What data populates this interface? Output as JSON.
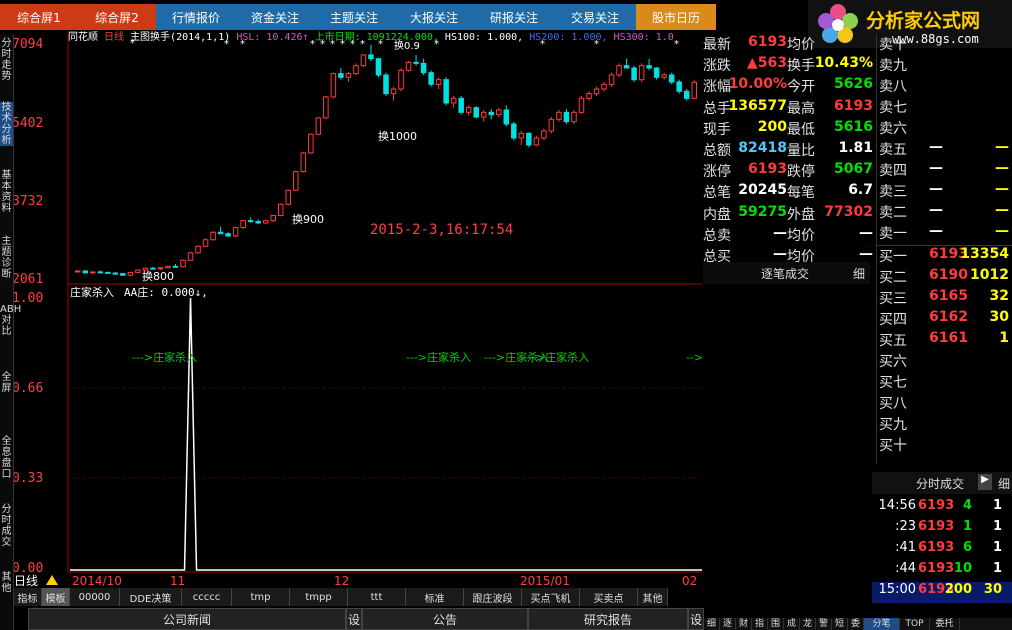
{
  "tabs": [
    "综合屏1",
    "综合屏2",
    "行情报价",
    "资金关注",
    "主题关注",
    "大报关注",
    "研报关注",
    "交易关注",
    "股市日历"
  ],
  "logo": {
    "title": "分析家公式网",
    "url": "www.88gs.com"
  },
  "left_nav": [
    "分时走势",
    "技术分析",
    "基本资料",
    "主题诊断",
    "ABH对比",
    "全屏",
    "全息盘口",
    "分时成交",
    "其他"
  ],
  "chart": {
    "header": {
      "name": "同花顺",
      "period": "日线",
      "indicator": "主图换手(2014,1,1)",
      "hsl": "HSL: 10.426↑",
      "listing": "上市日期: 1091224.000,",
      "hs100": "HS100: 1.000,",
      "hs200": "HS200: 1.000,",
      "hs300": "HS300: 1.0"
    },
    "y_labels": [
      "7094",
      "5402",
      "3732",
      "2061"
    ],
    "annotations": [
      "换1000",
      "换900",
      "换800",
      "换0.9"
    ],
    "timestamp": "2015-2-3,16:17:54",
    "sub_title": "庄家杀入",
    "sub_value": "AA庄: 0.000↓,",
    "sub_y_labels": [
      "1.00",
      "0.66",
      "0.33",
      "0.00"
    ],
    "sub_arrow_labels": [
      "--->庄家杀入",
      "--->庄家杀入",
      "--->庄家杀入",
      "--->庄家杀入",
      "-->"
    ],
    "x_labels": [
      "日线",
      "2014/10",
      "11",
      "12",
      "2015/01",
      "02"
    ]
  },
  "candles": [
    [
      2140,
      2165,
      2120,
      2150
    ],
    [
      2150,
      2170,
      2100,
      2110
    ],
    [
      2110,
      2140,
      2090,
      2130
    ],
    [
      2130,
      2160,
      2110,
      2120
    ],
    [
      2120,
      2135,
      2095,
      2105
    ],
    [
      2105,
      2130,
      2080,
      2095
    ],
    [
      2095,
      2110,
      2050,
      2060
    ],
    [
      2060,
      2130,
      2040,
      2120
    ],
    [
      2120,
      2180,
      2100,
      2170
    ],
    [
      2170,
      2220,
      2150,
      2210
    ],
    [
      2210,
      2240,
      2180,
      2195
    ],
    [
      2195,
      2230,
      2170,
      2220
    ],
    [
      2220,
      2260,
      2200,
      2250
    ],
    [
      2250,
      2300,
      2230,
      2240
    ],
    [
      2240,
      2400,
      2230,
      2380
    ],
    [
      2380,
      2560,
      2360,
      2540
    ],
    [
      2540,
      2700,
      2520,
      2680
    ],
    [
      2680,
      2850,
      2660,
      2820
    ],
    [
      2820,
      3000,
      2800,
      2980
    ],
    [
      2980,
      3100,
      2940,
      2950
    ],
    [
      2950,
      2980,
      2880,
      2900
    ],
    [
      2900,
      3100,
      2880,
      3080
    ],
    [
      3080,
      3250,
      3050,
      3230
    ],
    [
      3230,
      3300,
      3190,
      3210
    ],
    [
      3210,
      3260,
      3150,
      3180
    ],
    [
      3180,
      3250,
      3160,
      3230
    ],
    [
      3230,
      3350,
      3200,
      3340
    ],
    [
      3340,
      3600,
      3320,
      3580
    ],
    [
      3580,
      3900,
      3560,
      3880
    ],
    [
      3880,
      4300,
      3860,
      4280
    ],
    [
      4280,
      4700,
      4260,
      4680
    ],
    [
      4680,
      5100,
      4660,
      5080
    ],
    [
      5080,
      5450,
      5060,
      5430
    ],
    [
      5430,
      5900,
      5400,
      5880
    ],
    [
      5880,
      6400,
      5850,
      6380
    ],
    [
      6380,
      6500,
      6250,
      6300
    ],
    [
      6300,
      6420,
      6200,
      6380
    ],
    [
      6380,
      6600,
      6350,
      6550
    ],
    [
      6550,
      6800,
      6520,
      6780
    ],
    [
      6780,
      7000,
      6650,
      6700
    ],
    [
      6700,
      6720,
      6300,
      6350
    ],
    [
      6350,
      6400,
      5900,
      5950
    ],
    [
      5950,
      6100,
      5800,
      6050
    ],
    [
      6050,
      6500,
      6000,
      6450
    ],
    [
      6450,
      6650,
      6420,
      6620
    ],
    [
      6620,
      6780,
      6550,
      6600
    ],
    [
      6600,
      6700,
      6350,
      6400
    ],
    [
      6400,
      6450,
      6100,
      6150
    ],
    [
      6150,
      6300,
      6050,
      6250
    ],
    [
      6250,
      6300,
      5700,
      5750
    ],
    [
      5750,
      5900,
      5650,
      5850
    ],
    [
      5850,
      5900,
      5500,
      5550
    ],
    [
      5550,
      5700,
      5480,
      5650
    ],
    [
      5650,
      5680,
      5420,
      5450
    ],
    [
      5450,
      5600,
      5350,
      5550
    ],
    [
      5550,
      5620,
      5400,
      5500
    ],
    [
      5500,
      5650,
      5450,
      5600
    ],
    [
      5600,
      5700,
      5250,
      5300
    ],
    [
      5300,
      5350,
      4950,
      5000
    ],
    [
      5000,
      5150,
      4850,
      5100
    ],
    [
      5100,
      5120,
      4800,
      4850
    ],
    [
      4850,
      5050,
      4820,
      5000
    ],
    [
      5000,
      5200,
      4950,
      5150
    ],
    [
      5150,
      5450,
      5100,
      5400
    ],
    [
      5400,
      5600,
      5350,
      5550
    ],
    [
      5550,
      5620,
      5300,
      5350
    ],
    [
      5350,
      5600,
      5300,
      5550
    ],
    [
      5550,
      5900,
      5520,
      5850
    ],
    [
      5850,
      6000,
      5800,
      5950
    ],
    [
      5950,
      6100,
      5900,
      6050
    ],
    [
      6050,
      6200,
      6000,
      6150
    ],
    [
      6150,
      6400,
      6100,
      6350
    ],
    [
      6350,
      6600,
      6300,
      6550
    ],
    [
      6550,
      6700,
      6500,
      6500
    ],
    [
      6500,
      6550,
      6200,
      6250
    ],
    [
      6250,
      6600,
      6200,
      6550
    ],
    [
      6550,
      6700,
      6450,
      6500
    ],
    [
      6500,
      6520,
      6250,
      6300
    ],
    [
      6300,
      6400,
      6250,
      6350
    ],
    [
      6350,
      6400,
      6150,
      6200
    ],
    [
      6200,
      6250,
      5950,
      6000
    ],
    [
      6000,
      6050,
      5800,
      5850
    ],
    [
      5850,
      6250,
      5830,
      6193
    ]
  ],
  "sub_spikes": [
    15,
    93,
    113,
    124,
    170
  ],
  "quote": [
    {
      "l": "最新",
      "v": "6193",
      "c": "red",
      "l2": "均价",
      "v2": ""
    },
    {
      "l": "涨跌",
      "v": "▲563",
      "c": "red",
      "l2": "换手",
      "v2": "10.43%",
      "c2": "yel"
    },
    {
      "l": "涨幅",
      "v": "10.00%",
      "c": "red",
      "l2": "今开",
      "v2": "5626",
      "c2": "grn"
    },
    {
      "l": "总手",
      "v": "136577",
      "c": "yel",
      "l2": "最高",
      "v2": "6193",
      "c2": "red"
    },
    {
      "l": "现手",
      "v": "200",
      "c": "yel",
      "l2": "最低",
      "v2": "5616",
      "c2": "grn"
    },
    {
      "l": "总额",
      "v": "82418",
      "c": "cyn",
      "l2": "量比",
      "v2": "1.81",
      "c2": "wht"
    },
    {
      "l": "涨停",
      "v": "6193",
      "c": "red",
      "l2": "跌停",
      "v2": "5067",
      "c2": "grn"
    },
    {
      "l": "总笔",
      "v": "20245",
      "c": "wht",
      "l2": "每笔",
      "v2": "6.7",
      "c2": "wht"
    },
    {
      "l": "内盘",
      "v": "59275",
      "c": "grn",
      "l2": "外盘",
      "v2": "77302",
      "c2": "red"
    },
    {
      "l": "总卖",
      "v": "—",
      "c": "wht",
      "l2": "均价",
      "v2": "—",
      "c2": "wht"
    },
    {
      "l": "总买",
      "v": "—",
      "c": "wht",
      "l2": "均价",
      "v2": "—",
      "c2": "wht"
    }
  ],
  "zbcj": {
    "label": "逐笔成交",
    "btn": "细"
  },
  "orderbook": {
    "sells": [
      [
        "卖十",
        "",
        ""
      ],
      [
        "卖九",
        "",
        ""
      ],
      [
        "卖八",
        "",
        ""
      ],
      [
        "卖七",
        "",
        ""
      ],
      [
        "卖六",
        "",
        ""
      ],
      [
        "卖五",
        "—",
        "—"
      ],
      [
        "卖四",
        "—",
        "—"
      ],
      [
        "卖三",
        "—",
        "—"
      ],
      [
        "卖二",
        "—",
        "—"
      ],
      [
        "卖一",
        "—",
        "—"
      ]
    ],
    "buys": [
      [
        "买一",
        "6193",
        "13354"
      ],
      [
        "买二",
        "6190",
        "1012"
      ],
      [
        "买三",
        "6165",
        "32"
      ],
      [
        "买四",
        "6162",
        "30"
      ],
      [
        "买五",
        "6161",
        "1"
      ],
      [
        "买六",
        "",
        ""
      ],
      [
        "买七",
        "",
        ""
      ],
      [
        "买八",
        "",
        ""
      ],
      [
        "买九",
        "",
        ""
      ],
      [
        "买十",
        "",
        ""
      ]
    ]
  },
  "fenshi": {
    "title": "分时成交",
    "btn": "细",
    "rows": [
      [
        "14:56",
        "6193",
        "4",
        "1"
      ],
      [
        ":23",
        "6193",
        "1",
        "1"
      ],
      [
        ":41",
        "6193",
        "6",
        "1"
      ],
      [
        ":44",
        "6193",
        "10",
        "1"
      ],
      [
        "15:00",
        "6193",
        "200",
        "30"
      ]
    ]
  },
  "bottom": {
    "row1": [
      "指标",
      "模板",
      "00000",
      "DDE决策",
      "ccccc",
      "tmp",
      "tmpp",
      "ttt",
      "标准",
      "跟庄波段",
      "买点飞机",
      "买卖点",
      "其他"
    ],
    "row2": [
      "公司新闻",
      "设",
      "公告",
      "研究报告",
      "设"
    ],
    "right_tabs": [
      "细",
      "逐",
      "财",
      "指",
      "围",
      "成",
      "龙",
      "警",
      "短",
      "委",
      "分笔",
      "TOP",
      "委托"
    ]
  }
}
